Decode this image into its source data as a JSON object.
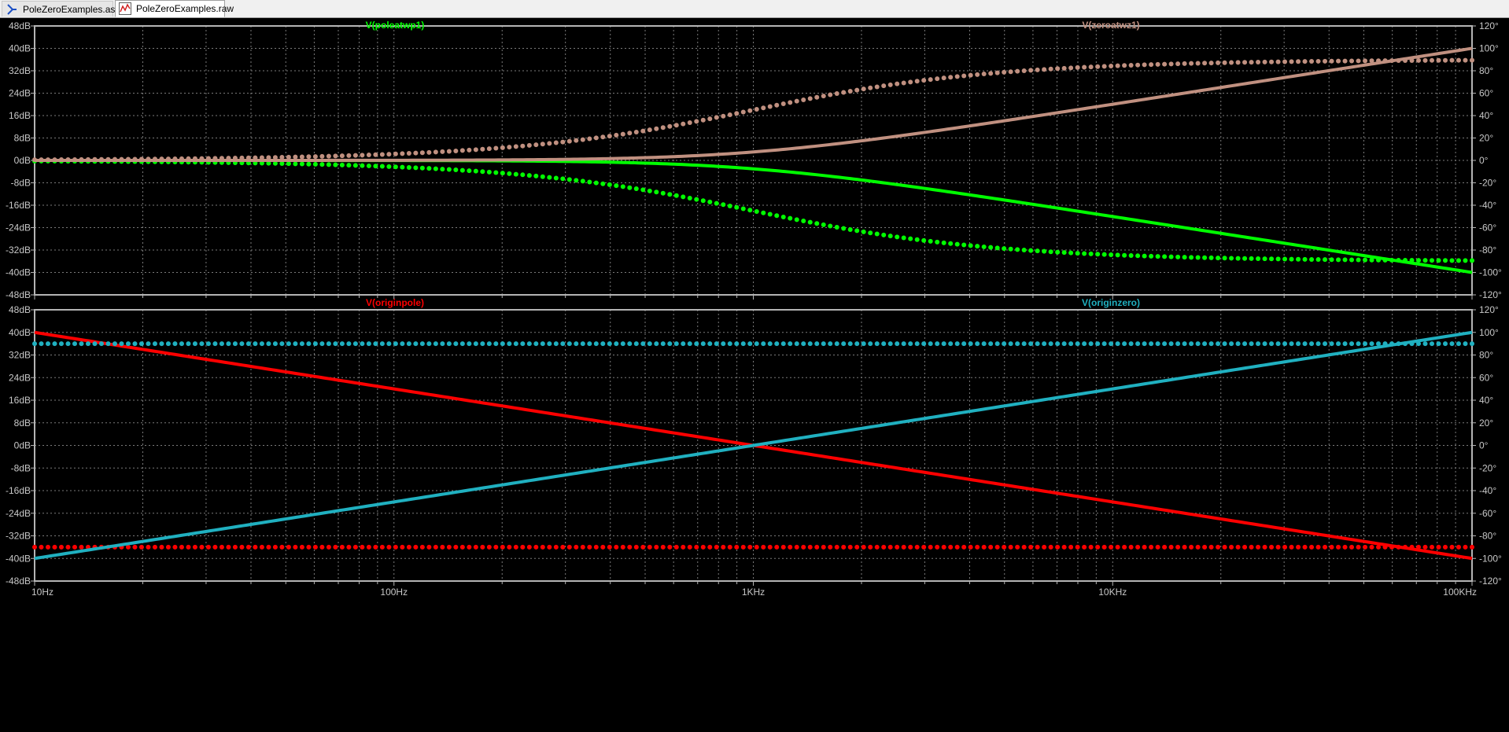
{
  "tabs": [
    {
      "label": "PoleZeroExamples.asc",
      "icon": "schematic-icon",
      "active": false
    },
    {
      "label": "PoleZeroExamples.raw",
      "icon": "waveform-icon",
      "active": true
    }
  ],
  "colors": {
    "background": "#000000",
    "frame": "#b4b4b4",
    "grid": "#7a7a7a",
    "axis_text": "#c8c8c8",
    "poleatwp1": "#00ff00",
    "zeroatwz1": "#c09080",
    "originpole": "#ff0000",
    "originzero": "#20b0c0"
  },
  "chart_data": [
    {
      "type": "line",
      "title": "",
      "x_scale": "log",
      "xlim": [
        10,
        100000
      ],
      "x_tick_labels": [
        "10Hz",
        "100Hz",
        "1KHz",
        "10KHz",
        "100KHz"
      ],
      "ylim": [
        -48,
        48
      ],
      "y_ticks": [
        48,
        40,
        32,
        24,
        16,
        8,
        0,
        -8,
        -16,
        -24,
        -32,
        -40,
        -48
      ],
      "y_tick_labels": [
        "48dB",
        "40dB",
        "32dB",
        "24dB",
        "16dB",
        "8dB",
        "0dB",
        "-8dB",
        "-16dB",
        "-24dB",
        "-32dB",
        "-40dB",
        "-48dB"
      ],
      "y2lim": [
        -120,
        120
      ],
      "y2_ticks": [
        120,
        100,
        80,
        60,
        40,
        20,
        0,
        -20,
        -40,
        -60,
        -80,
        -100,
        -120
      ],
      "y2_tick_labels": [
        "120°",
        "100°",
        "80°",
        "60°",
        "40°",
        "20°",
        "0°",
        "-20°",
        "-40°",
        "-60°",
        "-80°",
        "-100°",
        "-120°"
      ],
      "grid": true,
      "series": [
        {
          "name": "V(poleatwp1)",
          "color": "#00ff00",
          "kind": "pole",
          "corner_hz": 1000,
          "label_position": "left",
          "x": [
            10,
            100,
            1000,
            10000,
            100000
          ],
          "magnitude_db": [
            0,
            0,
            -3,
            -20,
            -40
          ],
          "phase_deg": [
            -0.6,
            -5.7,
            -45,
            -84.3,
            -89.4
          ]
        },
        {
          "name": "V(zeroatwz1)",
          "color": "#c09080",
          "kind": "zero",
          "corner_hz": 1000,
          "label_position": "right",
          "x": [
            10,
            100,
            1000,
            10000,
            100000
          ],
          "magnitude_db": [
            0,
            0,
            3,
            20,
            40
          ],
          "phase_deg": [
            0.6,
            5.7,
            45,
            84.3,
            89.4
          ]
        }
      ]
    },
    {
      "type": "line",
      "title": "",
      "x_scale": "log",
      "xlim": [
        10,
        100000
      ],
      "x_tick_labels": [
        "10Hz",
        "100Hz",
        "1KHz",
        "10KHz",
        "100KHz"
      ],
      "ylim": [
        -48,
        48
      ],
      "y_ticks": [
        48,
        40,
        32,
        24,
        16,
        8,
        0,
        -8,
        -16,
        -24,
        -32,
        -40,
        -48
      ],
      "y_tick_labels": [
        "48dB",
        "40dB",
        "32dB",
        "24dB",
        "16dB",
        "8dB",
        "0dB",
        "-8dB",
        "-16dB",
        "-24dB",
        "-32dB",
        "-40dB",
        "-48dB"
      ],
      "y2lim": [
        -120,
        120
      ],
      "y2_ticks": [
        120,
        100,
        80,
        60,
        40,
        20,
        0,
        -20,
        -40,
        -60,
        -80,
        -100,
        -120
      ],
      "y2_tick_labels": [
        "120°",
        "100°",
        "80°",
        "60°",
        "40°",
        "20°",
        "0°",
        "-20°",
        "-40°",
        "-60°",
        "-80°",
        "-100°",
        "-120°"
      ],
      "grid": true,
      "series": [
        {
          "name": "V(originpole)",
          "color": "#ff0000",
          "kind": "originpole",
          "label_position": "left",
          "x": [
            10,
            100,
            1000,
            10000,
            100000
          ],
          "magnitude_db": [
            40,
            20,
            0,
            -20,
            -40
          ],
          "phase_deg": [
            -90,
            -90,
            -90,
            -90,
            -90
          ]
        },
        {
          "name": "V(originzero)",
          "color": "#20b0c0",
          "kind": "originzero",
          "label_position": "right",
          "x": [
            10,
            100,
            1000,
            10000,
            100000
          ],
          "magnitude_db": [
            -40,
            -20,
            0,
            20,
            40
          ],
          "phase_deg": [
            90,
            90,
            90,
            90,
            90
          ]
        }
      ]
    }
  ]
}
